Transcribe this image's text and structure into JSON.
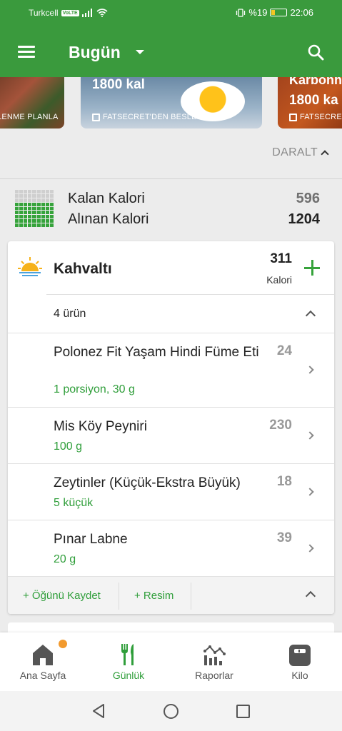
{
  "status_bar": {
    "carrier": "Turkcell",
    "volte": "VoLTE",
    "battery_percent": "%19",
    "time": "22:06"
  },
  "toolbar": {
    "title": "Bugün"
  },
  "banners": [
    {
      "subtitle": "LENME PLANLA"
    },
    {
      "calories": "1800 kal",
      "subtitle": "FATSECRET'DEN BESLENME"
    },
    {
      "title": "Karbonh",
      "calories": "1800 ka",
      "subtitle": "FATSECRET"
    }
  ],
  "collapse": {
    "label": "DARALT"
  },
  "summary": {
    "remaining_label": "Kalan Kalori",
    "remaining_value": "596",
    "consumed_label": "Alınan Kalori",
    "consumed_value": "1204"
  },
  "meal": {
    "title": "Kahvaltı",
    "calories": "311",
    "calories_unit": "Kalori",
    "items_count": "4 ürün",
    "items": [
      {
        "name": "Polonez Fit Yaşam Hindi Füme Eti",
        "portion": "1 porsiyon, 30 g",
        "calories": "24"
      },
      {
        "name": "Mis Köy Peyniri",
        "portion": "100 g",
        "calories": "230"
      },
      {
        "name": "Zeytinler (Küçük-Ekstra Büyük)",
        "portion": "5 küçük",
        "calories": "18"
      },
      {
        "name": "Pınar Labne",
        "portion": "20 g",
        "calories": "39"
      }
    ],
    "footer": {
      "save_label": "+ Öğünü Kaydet",
      "photo_label": "+ Resim"
    }
  },
  "bottom_nav": [
    {
      "label": "Ana Sayfa",
      "icon": "home-icon"
    },
    {
      "label": "Günlük",
      "icon": "fork-knife-icon",
      "active": true
    },
    {
      "label": "Raporlar",
      "icon": "chart-icon"
    },
    {
      "label": "Kilo",
      "icon": "scale-icon"
    }
  ],
  "colors": {
    "primary": "#3a9a3d",
    "accent_green": "#2f9e3a",
    "notification": "#f29a2e"
  }
}
